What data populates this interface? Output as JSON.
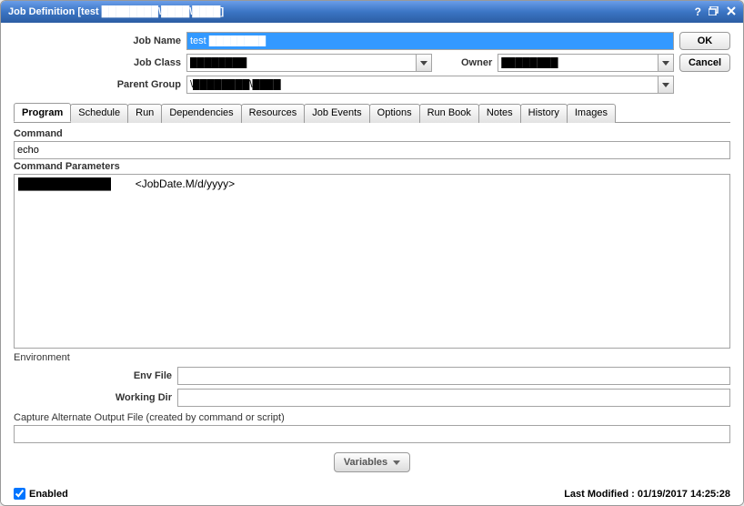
{
  "window": {
    "title": "Job Definition [test ████████\\████\\████]"
  },
  "buttons": {
    "ok": "OK",
    "cancel": "Cancel"
  },
  "form": {
    "jobName": {
      "label": "Job Name",
      "value": "test ████████"
    },
    "jobClass": {
      "label": "Job Class",
      "value": "████████"
    },
    "owner": {
      "label": "Owner",
      "value": "████████"
    },
    "parentGroup": {
      "label": "Parent Group",
      "value": "\\████████\\████"
    }
  },
  "tabs": [
    "Program",
    "Schedule",
    "Run",
    "Dependencies",
    "Resources",
    "Job Events",
    "Options",
    "Run Book",
    "Notes",
    "History",
    "Images"
  ],
  "activeTab": "Program",
  "program": {
    "commandLabel": "Command",
    "commandValue": "echo",
    "paramsLabel": "Command Parameters",
    "paramsValue": "████████████        <JobDate.M/d/yyyy>",
    "envLabel": "Environment",
    "envFile": {
      "label": "Env File",
      "value": ""
    },
    "workingDir": {
      "label": "Working Dir",
      "value": ""
    },
    "captureLabel": "Capture Alternate Output File (created by command or script)",
    "captureValue": "",
    "variablesBtn": "Variables"
  },
  "footer": {
    "enabled": "Enabled",
    "lastModified": "Last Modified : 01/19/2017 14:25:28"
  }
}
